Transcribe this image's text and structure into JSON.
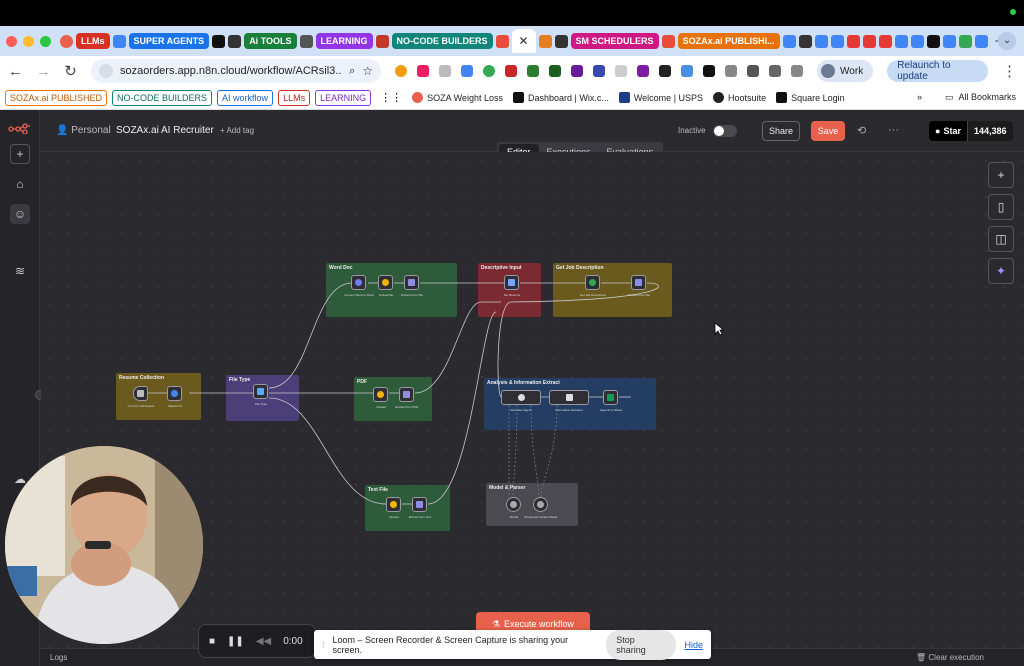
{
  "browser": {
    "tab_groups": [
      {
        "label": "LLMs",
        "color": "#d93025"
      },
      {
        "label": "SUPER AGENTS",
        "color": "#1a73e8"
      },
      {
        "label": "Ai TOOLS",
        "color": "#188038"
      },
      {
        "label": "LEARNING",
        "color": "#9334e6"
      },
      {
        "label": "NO-CODE BUILDERS",
        "color": "#12857a"
      },
      {
        "label": "SM SCHEDULERS",
        "color": "#d01884"
      },
      {
        "label": "SOZAx.ai PUBLISHI...",
        "color": "#e8710a"
      }
    ],
    "url": "sozaorders.app.n8n.cloud/workflow/ACRsil3...",
    "profile_label": "Work",
    "relaunch_label": "Relaunch to update",
    "bookmark_groups": [
      {
        "label": "SOZAx.ai PUBLISHED",
        "color": "#e8710a"
      },
      {
        "label": "NO-CODE BUILDERS",
        "color": "#12857a"
      },
      {
        "label": "AI workflow",
        "color": "#1a73e8"
      },
      {
        "label": "LLMs",
        "color": "#d93025"
      },
      {
        "label": "LEARNING",
        "color": "#9334e6"
      }
    ],
    "bookmarks": [
      "SOZA Weight Loss",
      "Dashboard | Wix.c...",
      "Welcome | USPS",
      "Hootsuite",
      "Square Login"
    ],
    "all_bookmarks_label": "All Bookmarks"
  },
  "n8n": {
    "project": "Personal",
    "workflow_name": "SOZAx.ai AI Recruiter",
    "add_tag": "+ Add tag",
    "status": "Inactive",
    "share": "Share",
    "save": "Save",
    "star_label": "Star",
    "star_count": "144,386",
    "tabs": [
      "Editor",
      "Executions",
      "Evaluations"
    ],
    "active_tab": "Editor",
    "execute_label": "Execute workflow",
    "logs_label": "Logs",
    "clear_label": "Clear execution",
    "groups": {
      "word_doc": "Word Doc",
      "descriptive_input": "Descriptive Input",
      "get_job_description": "Get Job Description",
      "resume_collection": "Resume Collection",
      "file_type": "File Type",
      "pdf": "PDF",
      "analysis": "Analysis & Information Extract",
      "text_file": "Text File",
      "model_parser": "Model & Parser"
    },
    "node_labels": {
      "convert": "Convert Word to Docs",
      "upload": "Upload file",
      "extract_doc": "Extract from File",
      "set_resume": "Set Resume",
      "get_desc": "Get Job Description",
      "extract_desc": "Extract from File",
      "form": "On form submission",
      "upload_resume": "Upload CV",
      "switch": "File Type",
      "pdf_upload": "Upload",
      "pdf_extract": "Extract from PDF",
      "recruiter": "Recruiter Agent",
      "info": "Information Extractor",
      "sheets": "Append to Sheet",
      "txt_upload": "Upload",
      "txt_extract": "Extract from Text",
      "model": "Model",
      "parser": "Structured Output Parser"
    }
  },
  "loom": {
    "timer": "0:00",
    "banner": "Loom – Screen Recorder & Screen Capture is sharing your screen.",
    "stop_sharing": "Stop sharing",
    "hide": "Hide"
  }
}
